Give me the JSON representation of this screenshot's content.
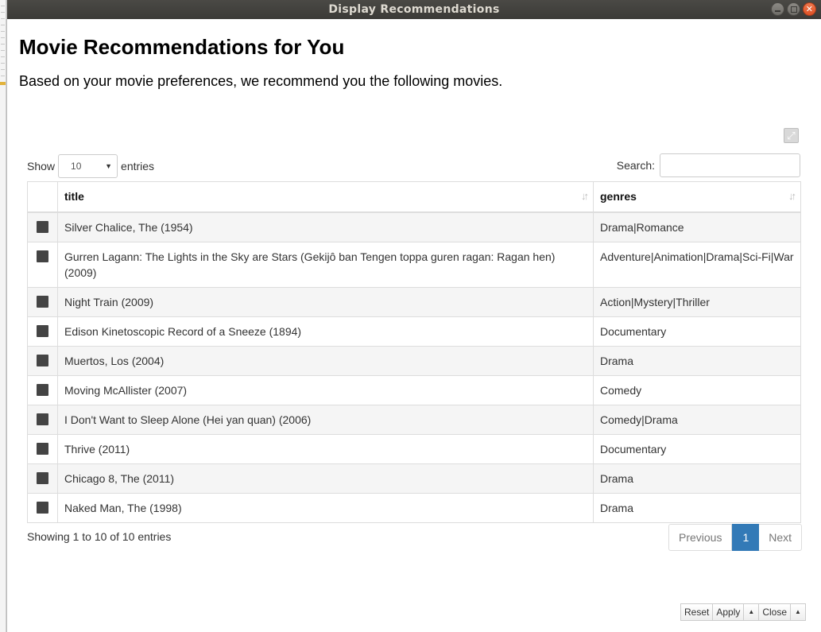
{
  "window": {
    "title": "Display Recommendations"
  },
  "page": {
    "heading": "Movie Recommendations for You",
    "subtitle": "Based on your movie preferences, we recommend you the following movies."
  },
  "table_controls": {
    "show_label": "Show",
    "page_length": "10",
    "entries_label": "entries",
    "search_label": "Search:",
    "search_value": ""
  },
  "table": {
    "columns": [
      "title",
      "genres"
    ],
    "rows": [
      {
        "title": "Silver Chalice, The (1954)",
        "genres": "Drama|Romance"
      },
      {
        "title": "Gurren Lagann: The Lights in the Sky are Stars (Gekijô ban Tengen toppa guren ragan: Ragan hen) (2009)",
        "genres": "Adventure|Animation|Drama|Sci-Fi|War"
      },
      {
        "title": "Night Train (2009)",
        "genres": "Action|Mystery|Thriller"
      },
      {
        "title": "Edison Kinetoscopic Record of a Sneeze (1894)",
        "genres": "Documentary"
      },
      {
        "title": "Muertos, Los (2004)",
        "genres": "Drama"
      },
      {
        "title": "Moving McAllister (2007)",
        "genres": "Comedy"
      },
      {
        "title": "I Don't Want to Sleep Alone (Hei yan quan) (2006)",
        "genres": "Comedy|Drama"
      },
      {
        "title": "Thrive (2011)",
        "genres": "Documentary"
      },
      {
        "title": "Chicago 8, The (2011)",
        "genres": "Drama"
      },
      {
        "title": "Naked Man, The (1998)",
        "genres": "Drama"
      }
    ]
  },
  "footer": {
    "info": "Showing 1 to 10 of 10 entries",
    "pagination": {
      "previous": "Previous",
      "current": "1",
      "next": "Next"
    }
  },
  "bottom_bar": {
    "reset": "Reset",
    "apply": "Apply",
    "close": "Close"
  },
  "colors": {
    "accent": "#337ab7",
    "titlebar": "#3c3b37",
    "close_button": "#e9602f"
  }
}
